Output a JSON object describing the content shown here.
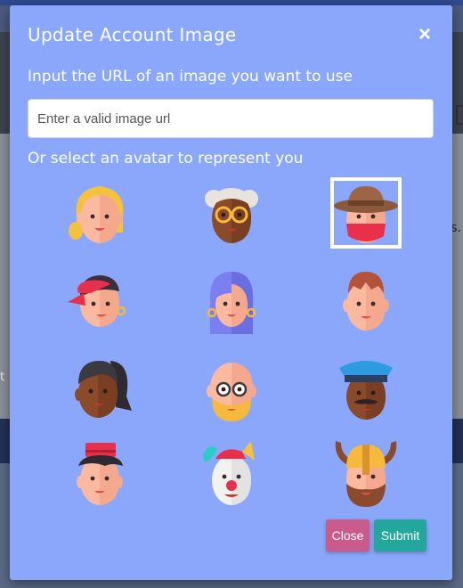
{
  "modal": {
    "title": "Update Account Image",
    "close_icon": "×",
    "url_prompt": "Input the URL of an image you want to use",
    "url_input": {
      "value": "",
      "placeholder": "Enter a valid image url"
    },
    "avatar_prompt": "Or select an avatar to represent you",
    "avatars": [
      {
        "name": "blonde-woman-avatar"
      },
      {
        "name": "grandma-with-glasses-avatar"
      },
      {
        "name": "cowboy-with-bandana-avatar",
        "selected": true
      },
      {
        "name": "girl-with-cap-avatar"
      },
      {
        "name": "woman-purple-hair-avatar"
      },
      {
        "name": "man-red-hair-avatar"
      },
      {
        "name": "woman-ponytail-avatar"
      },
      {
        "name": "bald-man-glasses-avatar"
      },
      {
        "name": "police-officer-avatar"
      },
      {
        "name": "bellhop-avatar"
      },
      {
        "name": "clown-avatar"
      },
      {
        "name": "viking-avatar"
      }
    ],
    "buttons": {
      "close": "Close",
      "submit": "Submit"
    }
  },
  "background": {
    "edge_text_right": "s.",
    "edge_text_left": "t"
  },
  "colors": {
    "modal_bg": "#8aa7fb",
    "close_button": "#cb5a8d",
    "submit_button": "#23a79c"
  }
}
